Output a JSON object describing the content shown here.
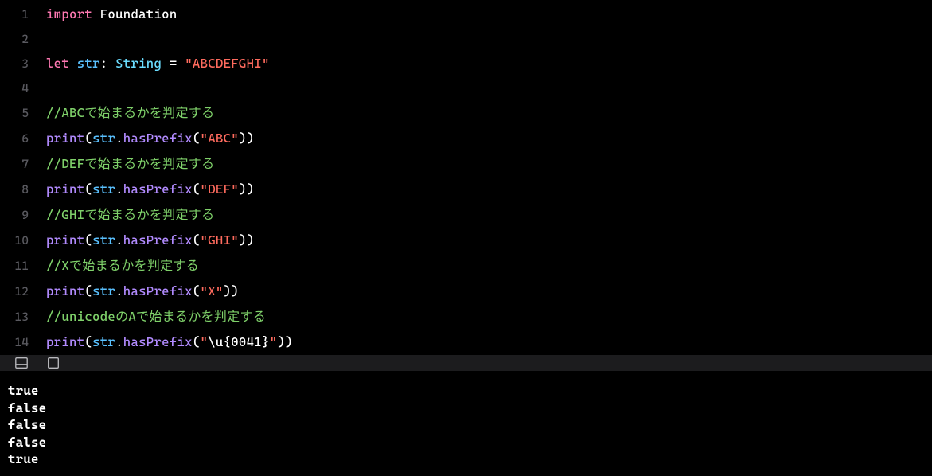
{
  "code": {
    "lines": [
      {
        "num": "1",
        "tokens": [
          {
            "c": "kw-import",
            "t": "import"
          },
          {
            "c": "punct",
            "t": " "
          },
          {
            "c": "punct",
            "t": "Foundation"
          }
        ]
      },
      {
        "num": "2",
        "tokens": []
      },
      {
        "num": "3",
        "tokens": [
          {
            "c": "kw-let",
            "t": "let"
          },
          {
            "c": "punct",
            "t": " "
          },
          {
            "c": "ident",
            "t": "str"
          },
          {
            "c": "punct",
            "t": ": "
          },
          {
            "c": "type",
            "t": "String"
          },
          {
            "c": "punct",
            "t": " = "
          },
          {
            "c": "string",
            "t": "\"ABCDEFGHI\""
          }
        ]
      },
      {
        "num": "4",
        "tokens": []
      },
      {
        "num": "5",
        "tokens": [
          {
            "c": "comment",
            "t": "//ABCで始まるかを判定する"
          }
        ]
      },
      {
        "num": "6",
        "tokens": [
          {
            "c": "func",
            "t": "print"
          },
          {
            "c": "punct",
            "t": "("
          },
          {
            "c": "ident",
            "t": "str"
          },
          {
            "c": "punct",
            "t": "."
          },
          {
            "c": "method",
            "t": "hasPrefix"
          },
          {
            "c": "punct",
            "t": "("
          },
          {
            "c": "string",
            "t": "\"ABC\""
          },
          {
            "c": "punct",
            "t": "))"
          }
        ]
      },
      {
        "num": "7",
        "tokens": [
          {
            "c": "comment",
            "t": "//DEFで始まるかを判定する"
          }
        ]
      },
      {
        "num": "8",
        "tokens": [
          {
            "c": "func",
            "t": "print"
          },
          {
            "c": "punct",
            "t": "("
          },
          {
            "c": "ident",
            "t": "str"
          },
          {
            "c": "punct",
            "t": "."
          },
          {
            "c": "method",
            "t": "hasPrefix"
          },
          {
            "c": "punct",
            "t": "("
          },
          {
            "c": "string",
            "t": "\"DEF\""
          },
          {
            "c": "punct",
            "t": "))"
          }
        ]
      },
      {
        "num": "9",
        "tokens": [
          {
            "c": "comment",
            "t": "//GHIで始まるかを判定する"
          }
        ]
      },
      {
        "num": "10",
        "tokens": [
          {
            "c": "func",
            "t": "print"
          },
          {
            "c": "punct",
            "t": "("
          },
          {
            "c": "ident",
            "t": "str"
          },
          {
            "c": "punct",
            "t": "."
          },
          {
            "c": "method",
            "t": "hasPrefix"
          },
          {
            "c": "punct",
            "t": "("
          },
          {
            "c": "string",
            "t": "\"GHI\""
          },
          {
            "c": "punct",
            "t": "))"
          }
        ]
      },
      {
        "num": "11",
        "tokens": [
          {
            "c": "comment",
            "t": "//Xで始まるかを判定する"
          }
        ]
      },
      {
        "num": "12",
        "tokens": [
          {
            "c": "func",
            "t": "print"
          },
          {
            "c": "punct",
            "t": "("
          },
          {
            "c": "ident",
            "t": "str"
          },
          {
            "c": "punct",
            "t": "."
          },
          {
            "c": "method",
            "t": "hasPrefix"
          },
          {
            "c": "punct",
            "t": "("
          },
          {
            "c": "string",
            "t": "\"X\""
          },
          {
            "c": "punct",
            "t": "))"
          }
        ]
      },
      {
        "num": "13",
        "tokens": [
          {
            "c": "comment",
            "t": "//unicodeのAで始まるかを判定する"
          }
        ]
      },
      {
        "num": "14",
        "tokens": [
          {
            "c": "func",
            "t": "print"
          },
          {
            "c": "punct",
            "t": "("
          },
          {
            "c": "ident",
            "t": "str"
          },
          {
            "c": "punct",
            "t": "."
          },
          {
            "c": "method",
            "t": "hasPrefix"
          },
          {
            "c": "punct",
            "t": "("
          },
          {
            "c": "string",
            "t": "\""
          },
          {
            "c": "esc",
            "t": "\\u{0041}"
          },
          {
            "c": "string",
            "t": "\""
          },
          {
            "c": "punct",
            "t": "))"
          }
        ]
      }
    ]
  },
  "output": {
    "lines": [
      "true",
      "false",
      "false",
      "false",
      "true"
    ]
  }
}
